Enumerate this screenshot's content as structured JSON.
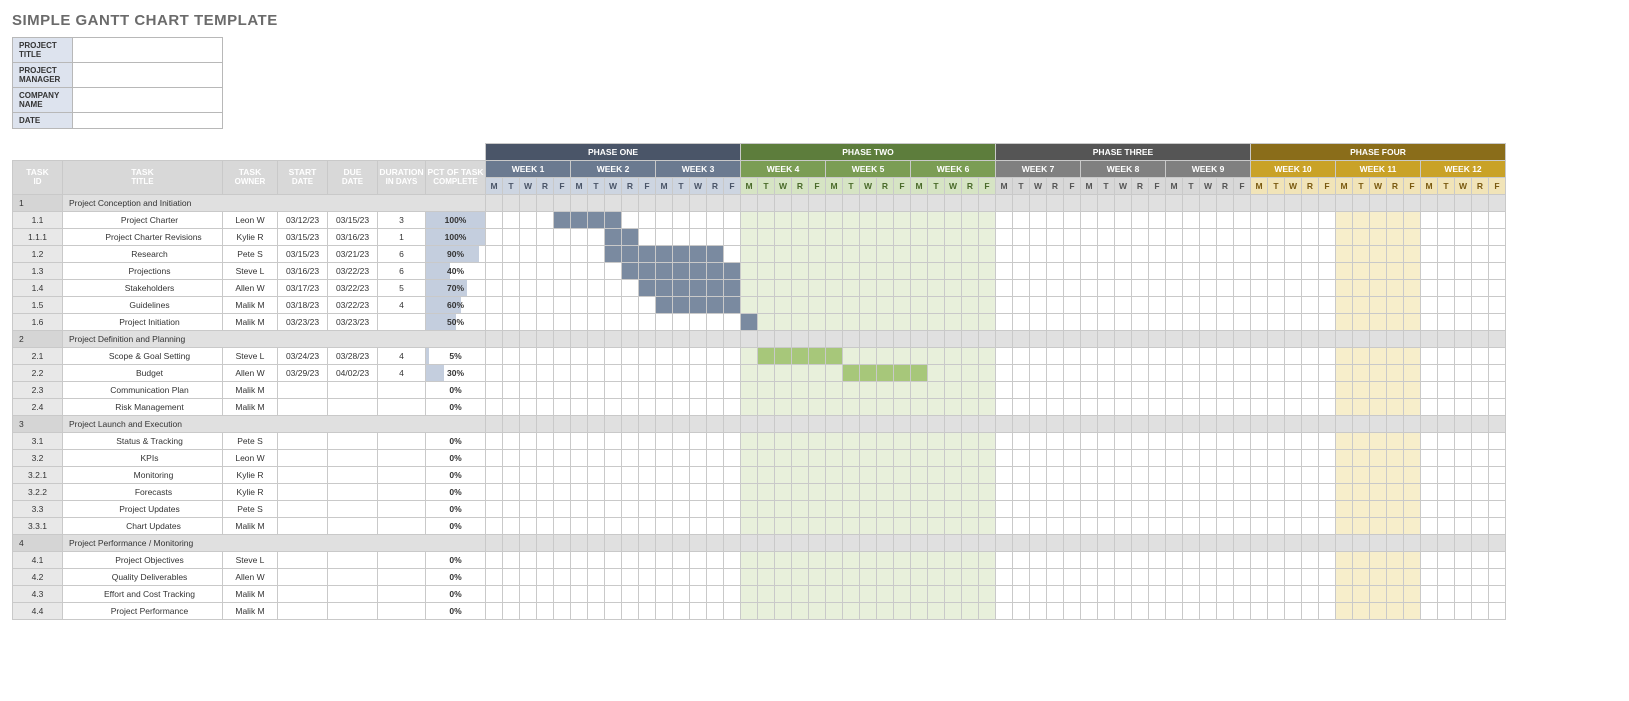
{
  "title": "SIMPLE GANTT CHART TEMPLATE",
  "meta": {
    "project_title_label": "PROJECT TITLE",
    "project_title_value": "",
    "project_manager_label": "PROJECT MANAGER",
    "project_manager_value": "",
    "company_name_label": "COMPANY NAME",
    "company_name_value": "",
    "date_label": "DATE",
    "date_value": ""
  },
  "columns": {
    "task_id": "TASK\nID",
    "task_title": "TASK\nTITLE",
    "task_owner": "TASK\nOWNER",
    "start_date": "START\nDATE",
    "due_date": "DUE\nDATE",
    "duration": "DURATION\nIN DAYS",
    "pct": "PCT OF TASK\nCOMPLETE"
  },
  "phases": [
    {
      "name": "PHASE ONE",
      "class": "1",
      "weeks": [
        "WEEK 1",
        "WEEK 2",
        "WEEK 3"
      ]
    },
    {
      "name": "PHASE TWO",
      "class": "2",
      "weeks": [
        "WEEK 4",
        "WEEK 5",
        "WEEK 6"
      ]
    },
    {
      "name": "PHASE THREE",
      "class": "3",
      "weeks": [
        "WEEK 7",
        "WEEK 8",
        "WEEK 9"
      ]
    },
    {
      "name": "PHASE FOUR",
      "class": "4",
      "weeks": [
        "WEEK 10",
        "WEEK 11",
        "WEEK 12"
      ]
    }
  ],
  "days": [
    "M",
    "T",
    "W",
    "R",
    "F"
  ],
  "week11_col_start": 50,
  "rows": [
    {
      "t": "s",
      "id": "1",
      "title": "Project Conception and Initiation"
    },
    {
      "t": "r",
      "id": "1.1",
      "title": "Project Charter",
      "ind": 1,
      "owner": "Leon W",
      "start": "03/12/23",
      "due": "03/15/23",
      "dur": "3",
      "pct": 100,
      "bar": {
        "phase": 1,
        "from": 5,
        "to": 8
      }
    },
    {
      "t": "r",
      "id": "1.1.1",
      "title": "Project Charter Revisions",
      "ind": 2,
      "owner": "Kylie R",
      "start": "03/15/23",
      "due": "03/16/23",
      "dur": "1",
      "pct": 100,
      "bar": {
        "phase": 1,
        "from": 8,
        "to": 9
      }
    },
    {
      "t": "r",
      "id": "1.2",
      "title": "Research",
      "ind": 1,
      "owner": "Pete S",
      "start": "03/15/23",
      "due": "03/21/23",
      "dur": "6",
      "pct": 90,
      "bar": {
        "phase": 1,
        "from": 8,
        "to": 14
      }
    },
    {
      "t": "r",
      "id": "1.3",
      "title": "Projections",
      "ind": 1,
      "owner": "Steve L",
      "start": "03/16/23",
      "due": "03/22/23",
      "dur": "6",
      "pct": 40,
      "bar": {
        "phase": 1,
        "from": 9,
        "to": 15
      }
    },
    {
      "t": "r",
      "id": "1.4",
      "title": "Stakeholders",
      "ind": 1,
      "owner": "Allen W",
      "start": "03/17/23",
      "due": "03/22/23",
      "dur": "5",
      "pct": 70,
      "bar": {
        "phase": 1,
        "from": 10,
        "to": 15
      }
    },
    {
      "t": "r",
      "id": "1.5",
      "title": "Guidelines",
      "ind": 1,
      "owner": "Malik M",
      "start": "03/18/23",
      "due": "03/22/23",
      "dur": "4",
      "pct": 60,
      "bar": {
        "phase": 1,
        "from": 11,
        "to": 15
      }
    },
    {
      "t": "r",
      "id": "1.6",
      "title": "Project Initiation",
      "ind": 1,
      "owner": "Malik M",
      "start": "03/23/23",
      "due": "03/23/23",
      "dur": "",
      "pct": 50,
      "bar": {
        "phase": 1,
        "from": 16,
        "to": 16
      }
    },
    {
      "t": "s",
      "id": "2",
      "title": "Project Definition and Planning"
    },
    {
      "t": "r",
      "id": "2.1",
      "title": "Scope & Goal Setting",
      "ind": 1,
      "owner": "Steve L",
      "start": "03/24/23",
      "due": "03/28/23",
      "dur": "4",
      "pct": 5,
      "bar": {
        "phase": 2,
        "from": 17,
        "to": 21
      }
    },
    {
      "t": "r",
      "id": "2.2",
      "title": "Budget",
      "ind": 1,
      "owner": "Allen W",
      "start": "03/29/23",
      "due": "04/02/23",
      "dur": "4",
      "pct": 30,
      "bar": {
        "phase": 2,
        "from": 22,
        "to": 26
      }
    },
    {
      "t": "r",
      "id": "2.3",
      "title": "Communication Plan",
      "ind": 1,
      "owner": "Malik M",
      "start": "",
      "due": "",
      "dur": "",
      "pct": 0
    },
    {
      "t": "r",
      "id": "2.4",
      "title": "Risk Management",
      "ind": 1,
      "owner": "Malik M",
      "start": "",
      "due": "",
      "dur": "",
      "pct": 0
    },
    {
      "t": "s",
      "id": "3",
      "title": "Project Launch and Execution"
    },
    {
      "t": "r",
      "id": "3.1",
      "title": "Status & Tracking",
      "ind": 1,
      "owner": "Pete S",
      "start": "",
      "due": "",
      "dur": "",
      "pct": 0
    },
    {
      "t": "r",
      "id": "3.2",
      "title": "KPIs",
      "ind": 1,
      "owner": "Leon W",
      "start": "",
      "due": "",
      "dur": "",
      "pct": 0
    },
    {
      "t": "r",
      "id": "3.2.1",
      "title": "Monitoring",
      "ind": 2,
      "owner": "Kylie R",
      "start": "",
      "due": "",
      "dur": "",
      "pct": 0
    },
    {
      "t": "r",
      "id": "3.2.2",
      "title": "Forecasts",
      "ind": 2,
      "owner": "Kylie R",
      "start": "",
      "due": "",
      "dur": "",
      "pct": 0
    },
    {
      "t": "r",
      "id": "3.3",
      "title": "Project Updates",
      "ind": 1,
      "owner": "Pete S",
      "start": "",
      "due": "",
      "dur": "",
      "pct": 0
    },
    {
      "t": "r",
      "id": "3.3.1",
      "title": "Chart Updates",
      "ind": 2,
      "owner": "Malik M",
      "start": "",
      "due": "",
      "dur": "",
      "pct": 0
    },
    {
      "t": "s",
      "id": "4",
      "title": "Project Performance / Monitoring"
    },
    {
      "t": "r",
      "id": "4.1",
      "title": "Project Objectives",
      "ind": 1,
      "owner": "Steve L",
      "start": "",
      "due": "",
      "dur": "",
      "pct": 0
    },
    {
      "t": "r",
      "id": "4.2",
      "title": "Quality Deliverables",
      "ind": 1,
      "owner": "Allen W",
      "start": "",
      "due": "",
      "dur": "",
      "pct": 0
    },
    {
      "t": "r",
      "id": "4.3",
      "title": "Effort and Cost Tracking",
      "ind": 1,
      "owner": "Malik M",
      "start": "",
      "due": "",
      "dur": "",
      "pct": 0
    },
    {
      "t": "r",
      "id": "4.4",
      "title": "Project Performance",
      "ind": 1,
      "owner": "Malik M",
      "start": "",
      "due": "",
      "dur": "",
      "pct": 0
    }
  ],
  "chart_data": {
    "type": "gantt",
    "title": "Simple Gantt Chart Template",
    "time_unit": "weekday (M–F) across 12 weeks",
    "weeks": 12,
    "days_per_week": 5,
    "series": [
      {
        "id": "1.1",
        "name": "Project Charter",
        "phase": 1,
        "start_day": 5,
        "end_day": 8,
        "pct_complete": 100
      },
      {
        "id": "1.1.1",
        "name": "Project Charter Revisions",
        "phase": 1,
        "start_day": 8,
        "end_day": 9,
        "pct_complete": 100
      },
      {
        "id": "1.2",
        "name": "Research",
        "phase": 1,
        "start_day": 8,
        "end_day": 14,
        "pct_complete": 90
      },
      {
        "id": "1.3",
        "name": "Projections",
        "phase": 1,
        "start_day": 9,
        "end_day": 15,
        "pct_complete": 40
      },
      {
        "id": "1.4",
        "name": "Stakeholders",
        "phase": 1,
        "start_day": 10,
        "end_day": 15,
        "pct_complete": 70
      },
      {
        "id": "1.5",
        "name": "Guidelines",
        "phase": 1,
        "start_day": 11,
        "end_day": 15,
        "pct_complete": 60
      },
      {
        "id": "1.6",
        "name": "Project Initiation",
        "phase": 1,
        "start_day": 16,
        "end_day": 16,
        "pct_complete": 50
      },
      {
        "id": "2.1",
        "name": "Scope & Goal Setting",
        "phase": 2,
        "start_day": 17,
        "end_day": 21,
        "pct_complete": 5
      },
      {
        "id": "2.2",
        "name": "Budget",
        "phase": 2,
        "start_day": 22,
        "end_day": 26,
        "pct_complete": 30
      }
    ],
    "phase_colors": {
      "1": "#7a8aa0",
      "2": "#a7c77a",
      "3": "#808080",
      "4": "#c9a227"
    }
  }
}
